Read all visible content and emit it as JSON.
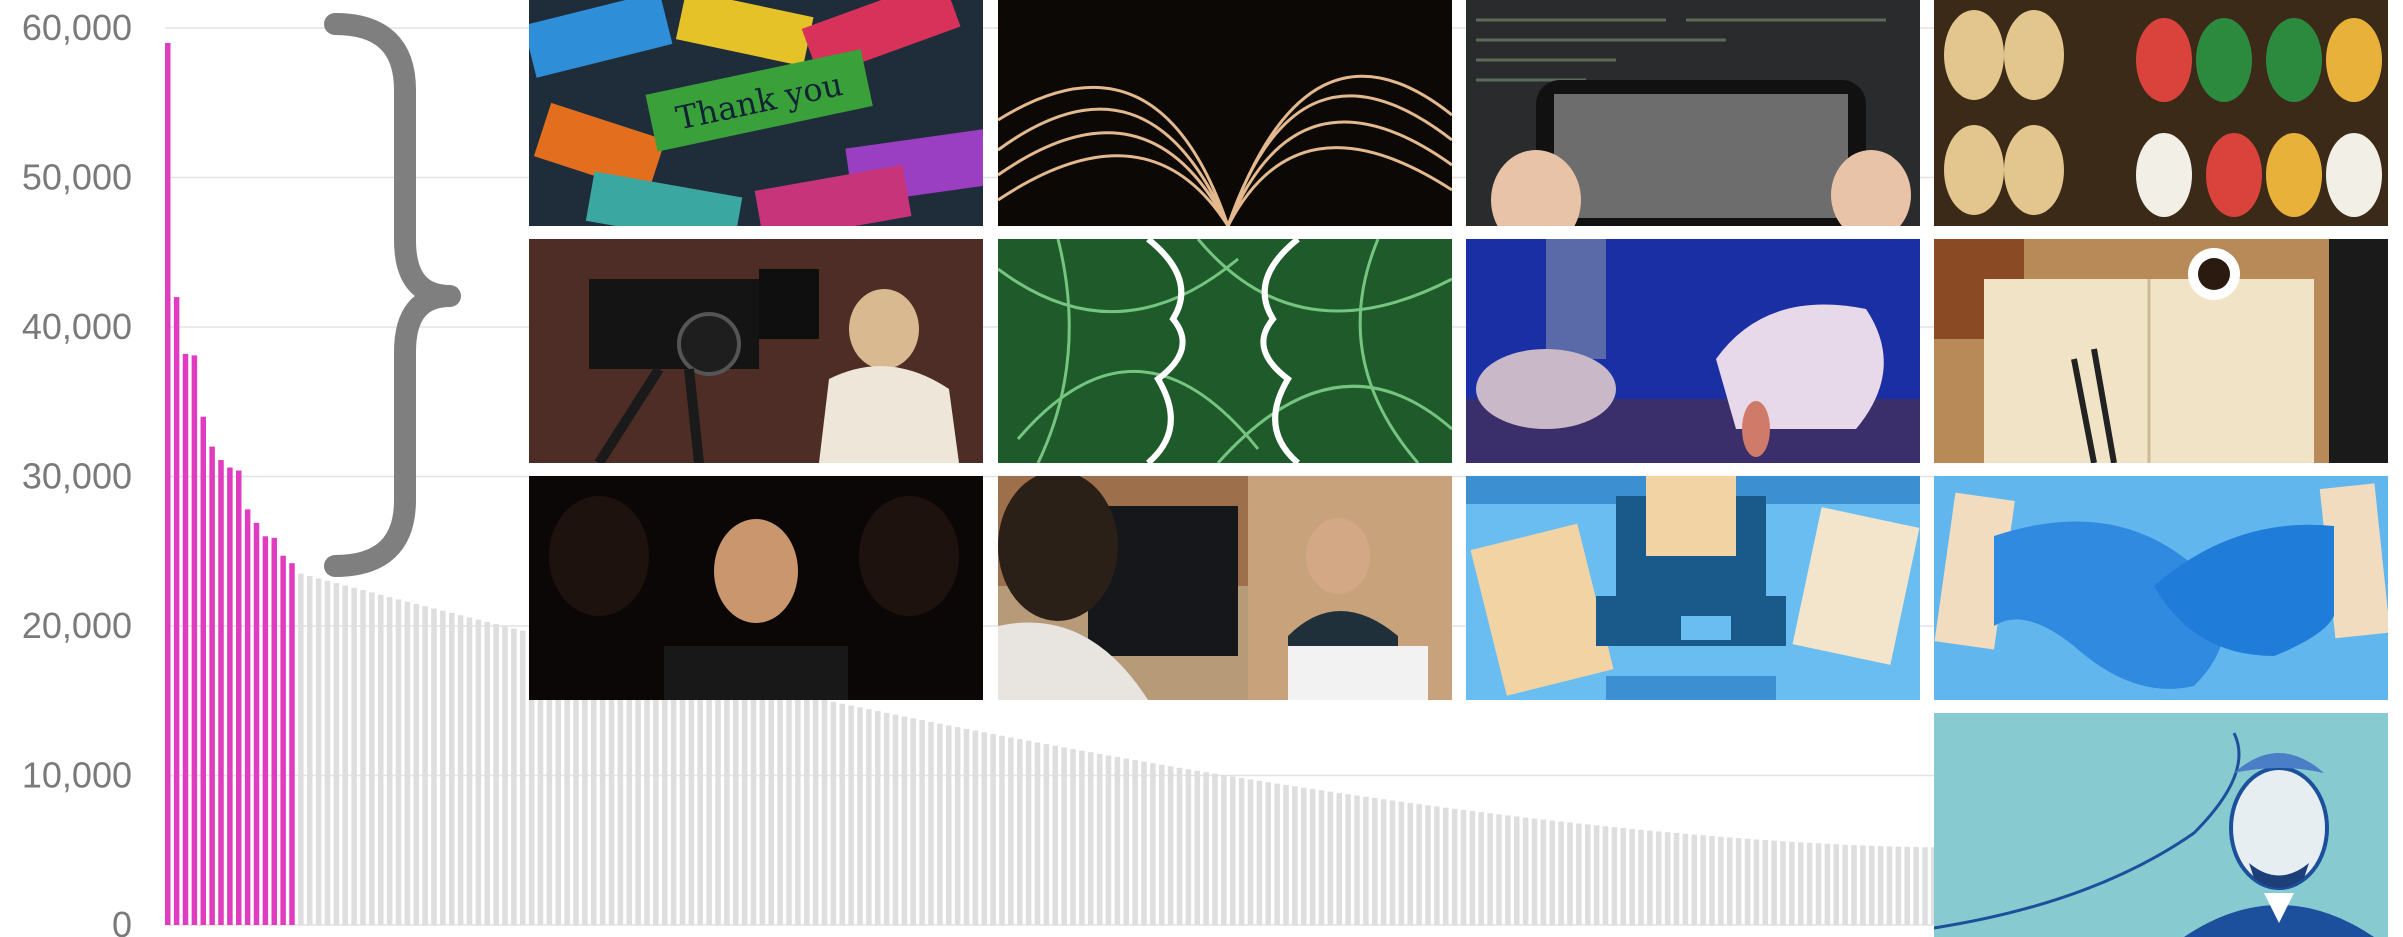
{
  "chart_data": {
    "type": "bar",
    "title": "",
    "xlabel": "",
    "ylabel": "",
    "ylim": [
      0,
      60000
    ],
    "grid": true,
    "y_ticks": [
      {
        "value": 0,
        "label": "0"
      },
      {
        "value": 10000,
        "label": "10,000"
      },
      {
        "value": 20000,
        "label": "20,000"
      },
      {
        "value": 30000,
        "label": "30,000"
      },
      {
        "value": 40000,
        "label": "40,000"
      },
      {
        "value": 50000,
        "label": "50,000"
      },
      {
        "value": 60000,
        "label": "60,000"
      }
    ],
    "highlight_count": 15,
    "highlight_color": "#e03cc0",
    "base_color": "#dedede",
    "highlighted_values": [
      59000,
      42000,
      38200,
      38100,
      34000,
      32000,
      31100,
      30600,
      30400,
      27800,
      26900,
      26000,
      25900,
      24700,
      24200
    ],
    "tail_start_value": 23500,
    "tail_end_value": 5200,
    "bar_count": 200
  },
  "thumbnails": [
    {
      "name": "thank-you-words",
      "label": "Thank you",
      "grid": [
        0,
        0
      ]
    },
    {
      "name": "open-book",
      "grid": [
        0,
        1
      ]
    },
    {
      "name": "smartphone-code",
      "grid": [
        0,
        2
      ]
    },
    {
      "name": "wooden-clogs",
      "grid": [
        0,
        3
      ]
    },
    {
      "name": "film-camera-operator",
      "grid": [
        1,
        0
      ]
    },
    {
      "name": "green-neural-faces",
      "grid": [
        1,
        1
      ]
    },
    {
      "name": "hand-on-mouse",
      "grid": [
        1,
        2
      ]
    },
    {
      "name": "notebook-desk",
      "grid": [
        1,
        3
      ]
    },
    {
      "name": "laptop-glow-face",
      "grid": [
        2,
        0
      ]
    },
    {
      "name": "office-conversation",
      "grid": [
        2,
        1
      ]
    },
    {
      "name": "laptop-documents-illustration",
      "grid": [
        2,
        2
      ]
    },
    {
      "name": "handshake-illustration",
      "grid": [
        2,
        3
      ]
    },
    {
      "name": "man-brain-illustration",
      "grid": [
        3,
        3
      ]
    }
  ],
  "colors": {
    "grid": "#e3e3e3",
    "tick_text": "#7a7a7a",
    "bracket": "#7f7f7f"
  }
}
